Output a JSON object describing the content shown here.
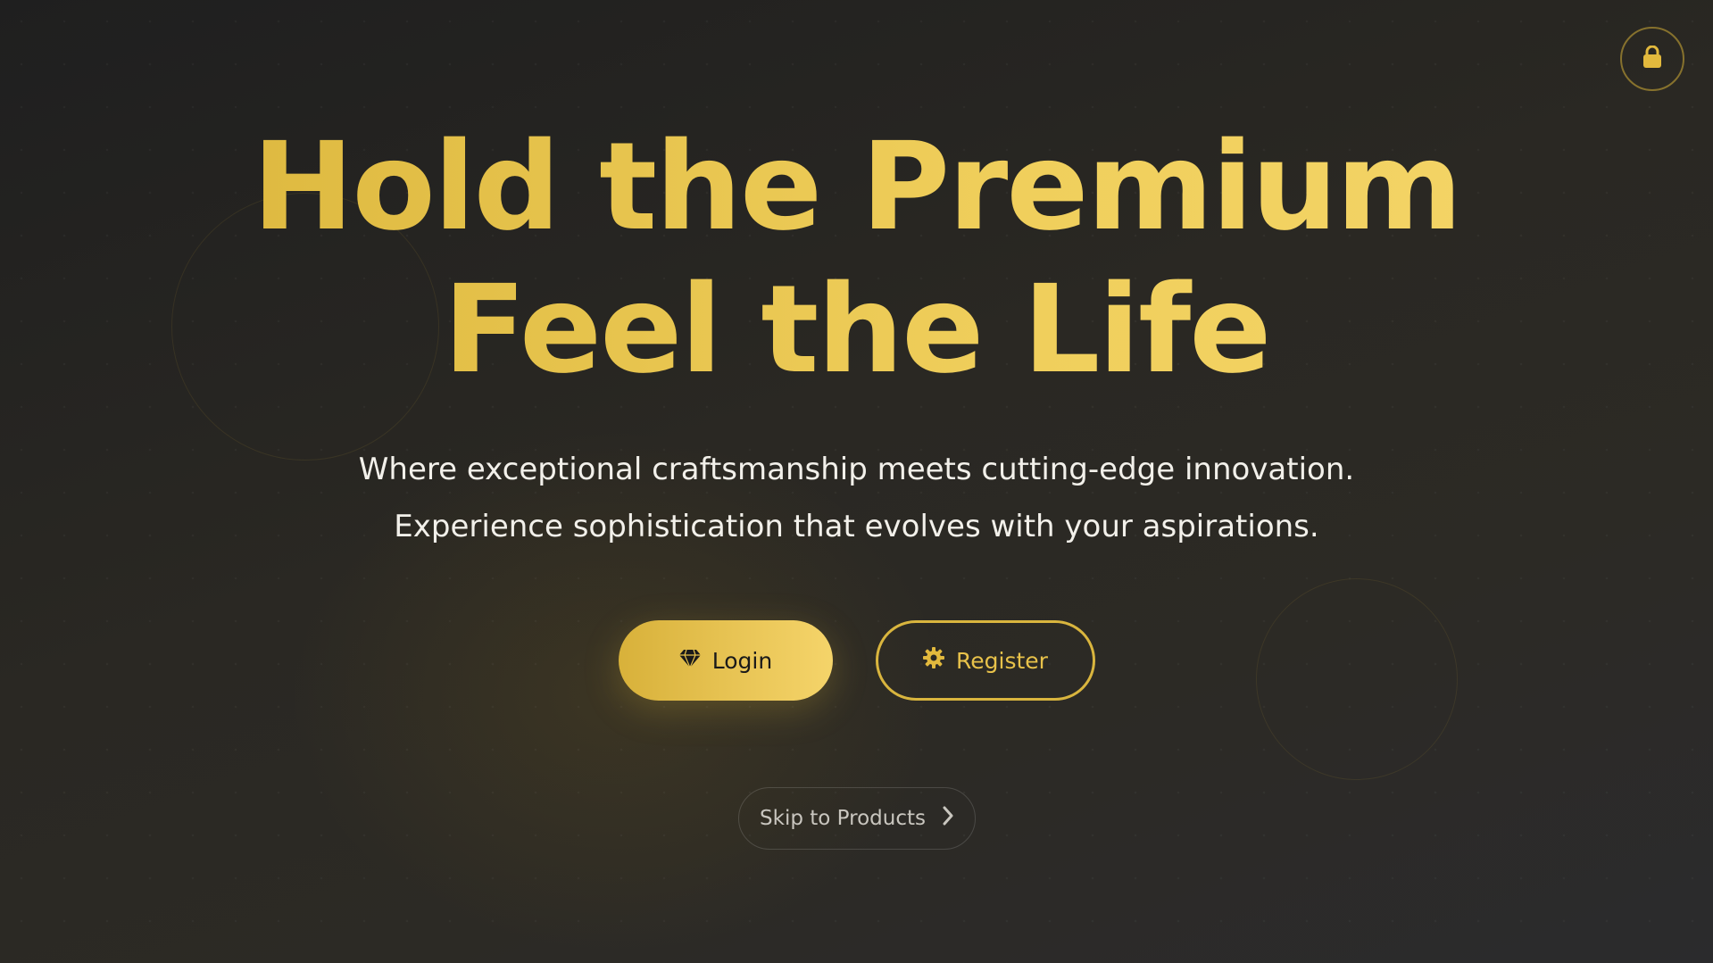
{
  "hero": {
    "headline_line1": "Hold the Premium",
    "headline_line2": "Feel the Life",
    "subtitle_line1": "Where exceptional craftsmanship meets cutting-edge innovation.",
    "subtitle_line2": "Experience sophistication that evolves with your aspirations."
  },
  "actions": {
    "login_label": "Login",
    "login_icon": "diamond-icon",
    "register_label": "Register",
    "register_icon": "gear-icon",
    "skip_label": "Skip to Products",
    "skip_icon": "chevron-right-icon"
  },
  "header": {
    "lock_icon": "lock-icon"
  },
  "colors": {
    "accent_gold": "#e8c24a",
    "background": "#262522",
    "text_light": "#f2f0ea"
  }
}
